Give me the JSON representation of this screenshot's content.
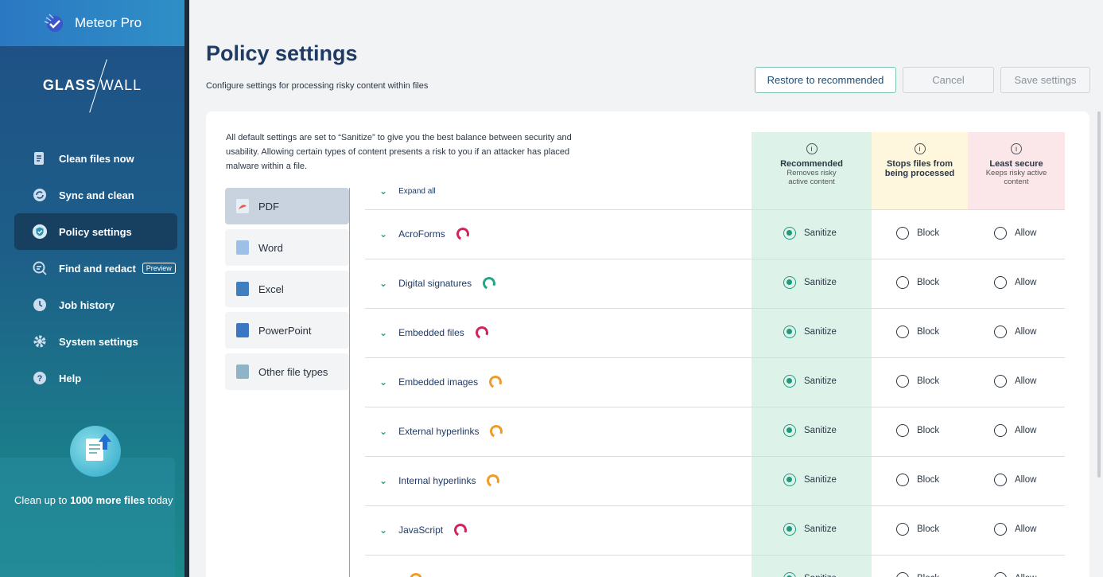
{
  "app": {
    "name": "Meteor Pro",
    "brand_left": "GLASS",
    "brand_right": "WALL"
  },
  "sidebar": {
    "items": [
      {
        "label": "Clean files now",
        "icon": "file-clean-icon"
      },
      {
        "label": "Sync and clean",
        "icon": "sync-icon"
      },
      {
        "label": "Policy settings",
        "icon": "shield-check-icon",
        "active": true
      },
      {
        "label": "Find and redact",
        "icon": "search-redact-icon",
        "badge": "Preview"
      },
      {
        "label": "Job history",
        "icon": "clock-icon"
      },
      {
        "label": "System settings",
        "icon": "gear-icon"
      },
      {
        "label": "Help",
        "icon": "help-icon"
      }
    ],
    "promo": {
      "text_prefix": "Clean up to ",
      "text_bold": "1000 more files",
      "text_suffix": " today"
    }
  },
  "header": {
    "title": "Policy settings",
    "subtitle": "Configure settings for processing risky content within files",
    "restore_label": "Restore to recommended",
    "cancel_label": "Cancel",
    "save_label": "Save settings"
  },
  "intro": "All default settings are set to “Sanitize” to give you the best balance between security and usability. Allowing certain types of content presents a risk to you if an attacker has placed malware within a file.",
  "file_types": [
    {
      "label": "PDF",
      "active": true,
      "color": "#e85c4a"
    },
    {
      "label": "Word",
      "color": "#9cc0e8"
    },
    {
      "label": "Excel",
      "color": "#3f7fc0"
    },
    {
      "label": "PowerPoint",
      "color": "#3b76c2"
    },
    {
      "label": "Other file types",
      "color": "#8fb4c8"
    }
  ],
  "columns": {
    "recommended": {
      "title": "Recommended",
      "desc1": "Removes risky",
      "desc2": "active content"
    },
    "block": {
      "title": "Stops files from",
      "title2": "being processed"
    },
    "allow": {
      "title": "Least secure",
      "desc1": "Keeps risky active",
      "desc2": "content"
    }
  },
  "expand_all": "Expand all",
  "options": {
    "sanitize": "Sanitize",
    "block": "Block",
    "allow": "Allow"
  },
  "rows": [
    {
      "name": "AcroForms",
      "risk": "high"
    },
    {
      "name": "Digital signatures",
      "risk": "low"
    },
    {
      "name": "Embedded files",
      "risk": "high"
    },
    {
      "name": "Embedded images",
      "risk": "med"
    },
    {
      "name": "External hyperlinks",
      "risk": "med"
    },
    {
      "name": "Internal hyperlinks",
      "risk": "med"
    },
    {
      "name": "JavaScript",
      "risk": "high"
    },
    {
      "name": "",
      "risk": "med"
    }
  ]
}
